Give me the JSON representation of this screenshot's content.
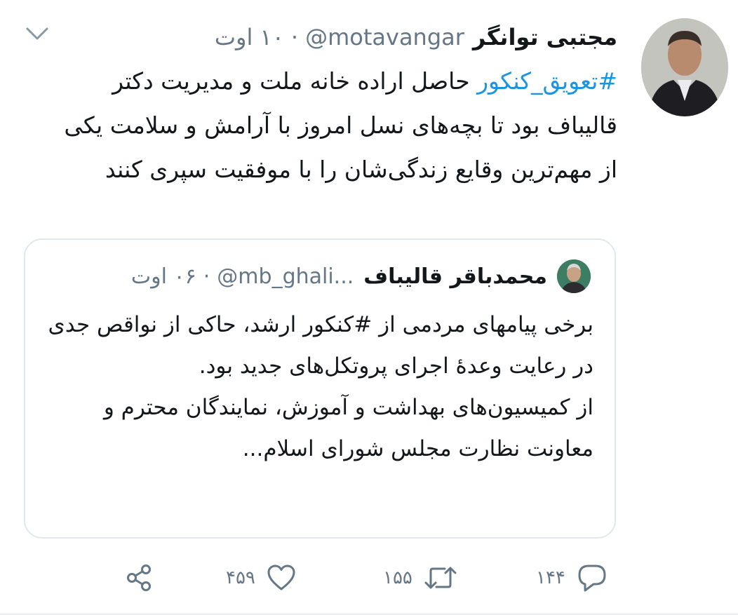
{
  "author": {
    "display_name": "مجتبی توانگر",
    "handle": "@motavangar",
    "separator": "·",
    "time": "۱۰ اوت"
  },
  "tweet": {
    "hashtag": "#تعویق_کنکور",
    "text": " حاصل اراده خانه ملت و مدیریت دکتر قالیباف بود تا بچه‌های نسل امروز با آرامش و سلامت یکی از مهم‌ترین وقایع زندگی‌شان را با موفقیت سپری کنند"
  },
  "quoted": {
    "display_name": "محمدباقر قالیباف",
    "handle": "@mb_ghali...",
    "separator": "·",
    "time": "۰۶ اوت",
    "line1": "برخی پیامهای مردمی از #کنکور ارشد، حاکی از نواقص جدی در رعایت وعدهٔ اجرای پروتکل‌های جدید بود.",
    "line2": "از کمیسیون‌های بهداشت و آموزش، نمایندگان محترم و معاونت نظارت مجلس شورای اسلام..."
  },
  "actions": {
    "reply_count": "۱۴۴",
    "retweet_count": "۱۵۵",
    "like_count": "۴۵۹"
  },
  "colors": {
    "hashtag": "#1b95e0",
    "secondary_text": "#657786",
    "icon": "#657786",
    "border": "#e1e8ed"
  },
  "icons": {
    "caret": "chevron-down-icon",
    "reply": "reply-icon",
    "retweet": "retweet-icon",
    "like": "heart-icon",
    "share": "share-icon"
  }
}
